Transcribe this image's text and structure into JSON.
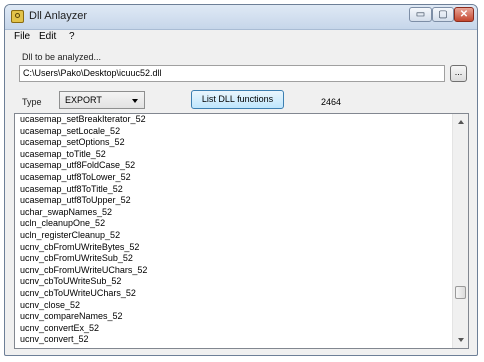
{
  "window": {
    "title": "Dll Anlayzer"
  },
  "titlebar": {
    "minimize": "▭",
    "maximize": "▢",
    "close": "✕"
  },
  "menu": [
    "File",
    "Edit",
    "?"
  ],
  "dll_section": {
    "label": "Dll to be analyzed...",
    "path": "C:\\Users\\Pako\\Desktop\\icuuc52.dll",
    "browse_label": "..."
  },
  "controls": {
    "type_label": "Type",
    "type_value": "EXPORT",
    "list_button": "List DLL functions",
    "count": "2464"
  },
  "functions": [
    "ucasemap_setBreakIterator_52",
    "ucasemap_setLocale_52",
    "ucasemap_setOptions_52",
    "ucasemap_toTitle_52",
    "ucasemap_utf8FoldCase_52",
    "ucasemap_utf8ToLower_52",
    "ucasemap_utf8ToTitle_52",
    "ucasemap_utf8ToUpper_52",
    "uchar_swapNames_52",
    "ucln_cleanupOne_52",
    "ucln_registerCleanup_52",
    "ucnv_cbFromUWriteBytes_52",
    "ucnv_cbFromUWriteSub_52",
    "ucnv_cbFromUWriteUChars_52",
    "ucnv_cbToUWriteSub_52",
    "ucnv_cbToUWriteUChars_52",
    "ucnv_close_52",
    "ucnv_compareNames_52",
    "ucnv_convertEx_52",
    "ucnv_convert_52"
  ]
}
